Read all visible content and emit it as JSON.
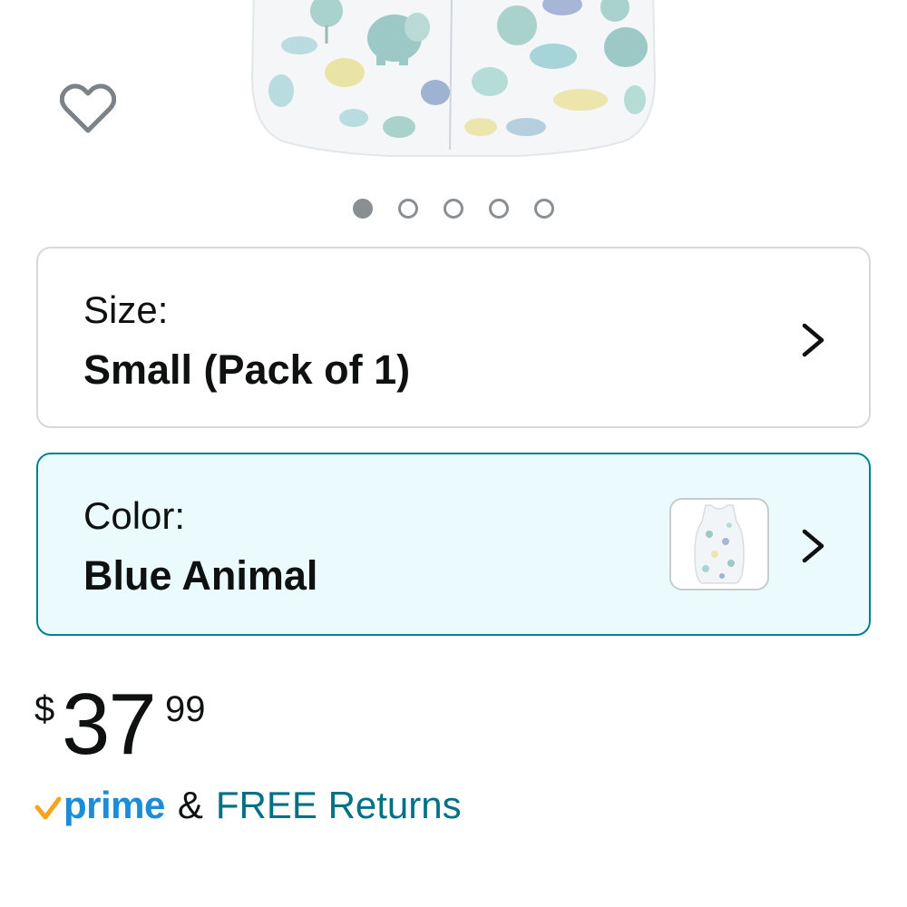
{
  "product": {
    "image_name": "baby-sleep-sack-blue-animal-print",
    "carousel": {
      "count": 5,
      "active_index": 0
    },
    "wishlist_icon": "heart-outline-icon"
  },
  "size_selector": {
    "label": "Size:",
    "value": "Small (Pack of 1)",
    "chevron_icon": "chevron-right-icon"
  },
  "color_selector": {
    "label": "Color:",
    "value": "Blue Animal",
    "swatch_icon": "sleep-sack-thumbnail",
    "chevron_icon": "chevron-right-icon",
    "selected": true
  },
  "price": {
    "symbol": "$",
    "whole": "37",
    "fraction": "99"
  },
  "delivery": {
    "prime_label": "prime",
    "ampersand": "&",
    "returns_label": "FREE Returns"
  },
  "colors": {
    "teal_border": "#00838f",
    "selected_bg": "#ebfbfd",
    "link": "#007185",
    "prime_blue": "#1a8cd8",
    "prime_check": "#f7a31c"
  }
}
